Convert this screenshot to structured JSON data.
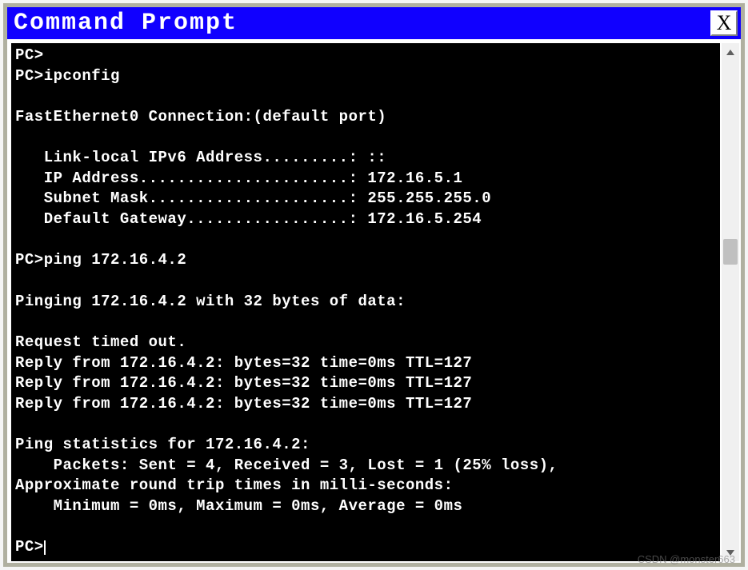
{
  "window": {
    "title": "Command Prompt",
    "close_label": "X"
  },
  "terminal": {
    "lines": [
      "PC>",
      "PC>ipconfig",
      "",
      "FastEthernet0 Connection:(default port)",
      "",
      "   Link-local IPv6 Address.........: ::",
      "   IP Address......................: 172.16.5.1",
      "   Subnet Mask.....................: 255.255.255.0",
      "   Default Gateway.................: 172.16.5.254",
      "",
      "PC>ping 172.16.4.2",
      "",
      "Pinging 172.16.4.2 with 32 bytes of data:",
      "",
      "Request timed out.",
      "Reply from 172.16.4.2: bytes=32 time=0ms TTL=127",
      "Reply from 172.16.4.2: bytes=32 time=0ms TTL=127",
      "Reply from 172.16.4.2: bytes=32 time=0ms TTL=127",
      "",
      "Ping statistics for 172.16.4.2:",
      "    Packets: Sent = 4, Received = 3, Lost = 1 (25% loss),",
      "Approximate round trip times in milli-seconds:",
      "    Minimum = 0ms, Maximum = 0ms, Average = 0ms",
      "",
      "PC>"
    ]
  },
  "watermark": "CSDN @monster663"
}
